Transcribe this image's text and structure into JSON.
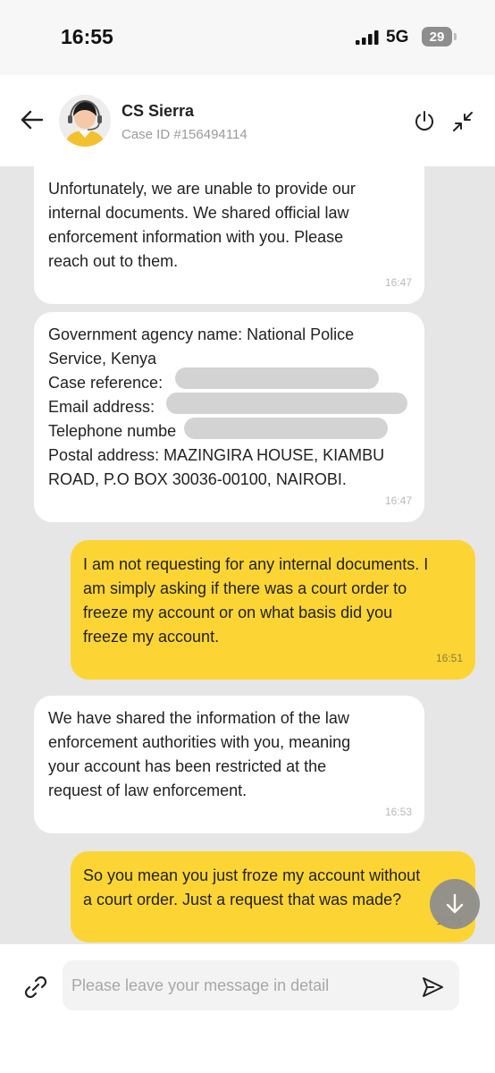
{
  "status": {
    "time": "16:55",
    "network": "5G",
    "battery": "29"
  },
  "header": {
    "agent_name": "CS Sierra",
    "case_id": "Case ID #156494114"
  },
  "messages": [
    {
      "sender": "agent",
      "text": "Unfortunately, we are unable to provide our\ninternal documents. We shared official law\nenforcement information with you. Please\nreach out to them.",
      "time": "16:47"
    },
    {
      "sender": "agent",
      "text": "Government agency name: National Police\nService, Kenya\nCase reference:\nEmail address:\nTelephone numbe\nPostal address: MAZINGIRA HOUSE, KIAMBU\nROAD, P.O BOX 30036-00100, NAIROBI.",
      "time": "16:47"
    },
    {
      "sender": "user",
      "text": "I am not requesting for any internal documents. I\nam simply asking if there was a court order to\nfreeze my account or on what basis did you\nfreeze my account.",
      "time": "16:51"
    },
    {
      "sender": "agent",
      "text": "We have shared the information of the law\nenforcement authorities with you, meaning\nyour account has been restricted at the\nrequest of law enforcement.",
      "time": "16:53"
    },
    {
      "sender": "user",
      "text": "So you mean you just froze my account without\na court order. Just a request that was made?",
      "time": "16:54"
    }
  ],
  "input": {
    "placeholder": "Please leave your message in detail"
  },
  "colors": {
    "accent": "#fcd535",
    "background": "#e6e6e6"
  },
  "icons": [
    "back-arrow-icon",
    "agent-avatar-icon",
    "power-icon",
    "minimize-icon",
    "scroll-down-icon",
    "link-icon",
    "send-icon"
  ]
}
